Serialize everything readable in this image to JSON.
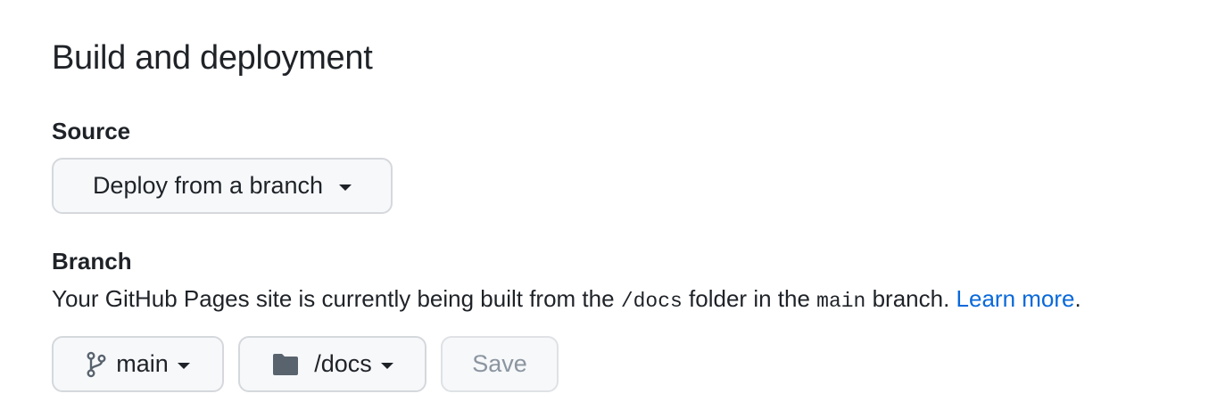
{
  "section": {
    "title": "Build and deployment"
  },
  "source": {
    "label": "Source",
    "dropdown_value": "Deploy from a branch"
  },
  "branch": {
    "label": "Branch",
    "description": {
      "part1": "Your GitHub Pages site is currently being built from the ",
      "folder_code": "/docs",
      "part2": " folder in the ",
      "branch_code": "main",
      "part3": " branch. ",
      "link_text": "Learn more",
      "end": "."
    },
    "branch_select": "main",
    "folder_select": "/docs",
    "save_label": "Save"
  },
  "icons": {
    "branch": "git-branch-icon",
    "folder": "folder-icon",
    "caret": "triangle-down-icon"
  },
  "colors": {
    "link": "#0969da",
    "disabled_text": "#8c959f",
    "button_bg": "#f6f8fa"
  }
}
